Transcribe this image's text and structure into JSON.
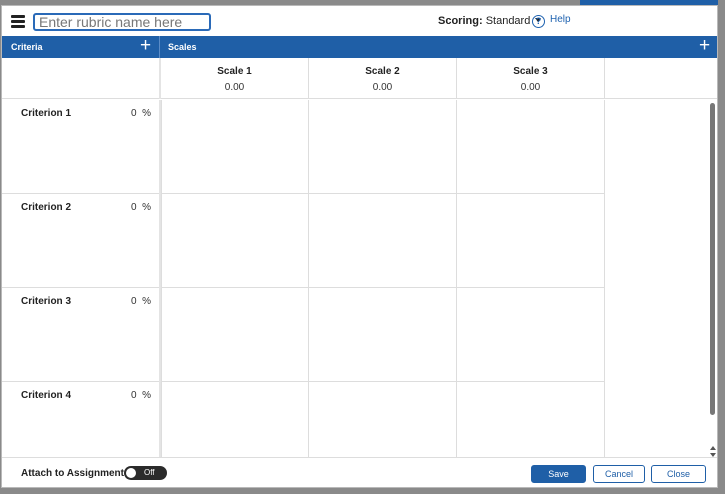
{
  "topbar": {
    "name_placeholder": "Enter rubric name here",
    "scoring_label": "Scoring:",
    "scoring_value": "Standard",
    "help_label": "Help"
  },
  "header": {
    "criteria_label": "Criteria",
    "scales_label": "Scales"
  },
  "scales": [
    {
      "name": "Scale 1",
      "value": "0.00"
    },
    {
      "name": "Scale 2",
      "value": "0.00"
    },
    {
      "name": "Scale 3",
      "value": "0.00"
    }
  ],
  "criteria": [
    {
      "name": "Criterion 1",
      "percent": "0",
      "unit": "%"
    },
    {
      "name": "Criterion 2",
      "percent": "0",
      "unit": "%"
    },
    {
      "name": "Criterion 3",
      "percent": "0",
      "unit": "%"
    },
    {
      "name": "Criterion 4",
      "percent": "0",
      "unit": "%"
    }
  ],
  "footer": {
    "attach_label": "Attach to Assignment",
    "toggle_state": "Off",
    "save_label": "Save",
    "cancel_label": "Cancel",
    "close_label": "Close"
  },
  "colors": {
    "accent": "#1f5fa7"
  }
}
